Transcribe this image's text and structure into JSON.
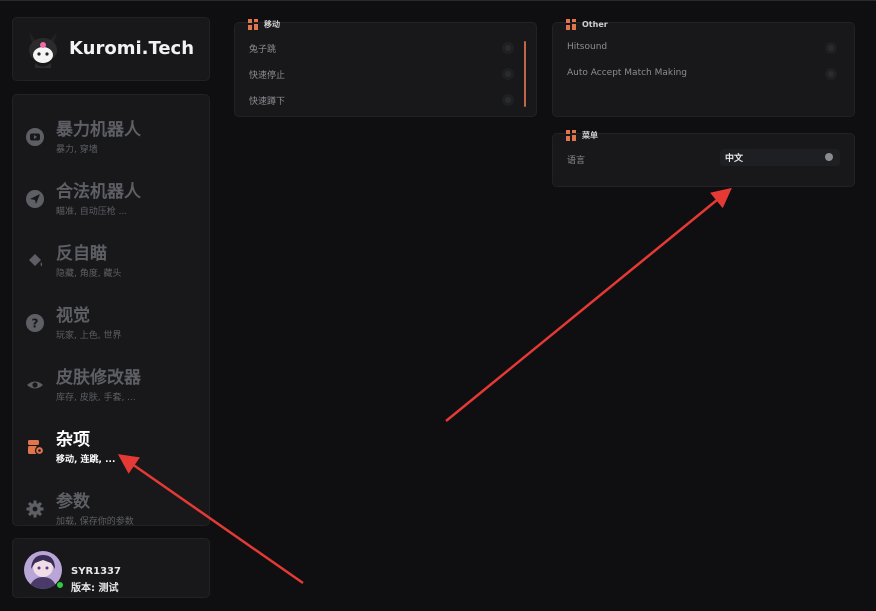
{
  "brand": {
    "name": "Kuromi.Tech",
    "logo_icon": "kuromi-icon"
  },
  "nav": {
    "items": [
      {
        "title": "暴力机器人",
        "subtitle": "暴力, 穿墙",
        "icon": "youtube-icon",
        "active": false
      },
      {
        "title": "合法机器人",
        "subtitle": "瞄准, 自动压枪 ...",
        "icon": "send-icon",
        "active": false
      },
      {
        "title": "反自瞄",
        "subtitle": "隐藏, 角度, 藏头",
        "icon": "paint-bucket-icon",
        "active": false
      },
      {
        "title": "视觉",
        "subtitle": "玩家, 上色, 世界",
        "icon": "question-icon",
        "active": false
      },
      {
        "title": "皮肤修改器",
        "subtitle": "库存, 皮肤, 手套, ...",
        "icon": "eye-icon",
        "active": false
      },
      {
        "title": "杂项",
        "subtitle": "移动, 连跳, ...",
        "icon": "misc-icon",
        "active": true
      },
      {
        "title": "参数",
        "subtitle": "加载, 保存你的参数",
        "icon": "gear-icon",
        "active": false
      }
    ]
  },
  "user": {
    "name": "SYR1337",
    "version": "版本: 测试",
    "status": "online"
  },
  "groups": {
    "movement": {
      "title": "移动",
      "rows": [
        {
          "label": "兔子跳",
          "enabled": false
        },
        {
          "label": "快速停止",
          "enabled": false
        },
        {
          "label": "快速蹲下",
          "enabled": false
        }
      ]
    },
    "other": {
      "title": "Other",
      "rows": [
        {
          "label": "Hitsound",
          "enabled": false
        },
        {
          "label": "Auto Accept Match Making",
          "enabled": false
        }
      ]
    },
    "menu": {
      "title": "菜单",
      "language_label": "语言",
      "language_value": "中文"
    }
  },
  "colors": {
    "accent": "#e0744b",
    "background": "#0f0f11",
    "panel": "#18181b",
    "inactive_text": "#5d5f64",
    "annotation_arrow": "#e53935"
  }
}
